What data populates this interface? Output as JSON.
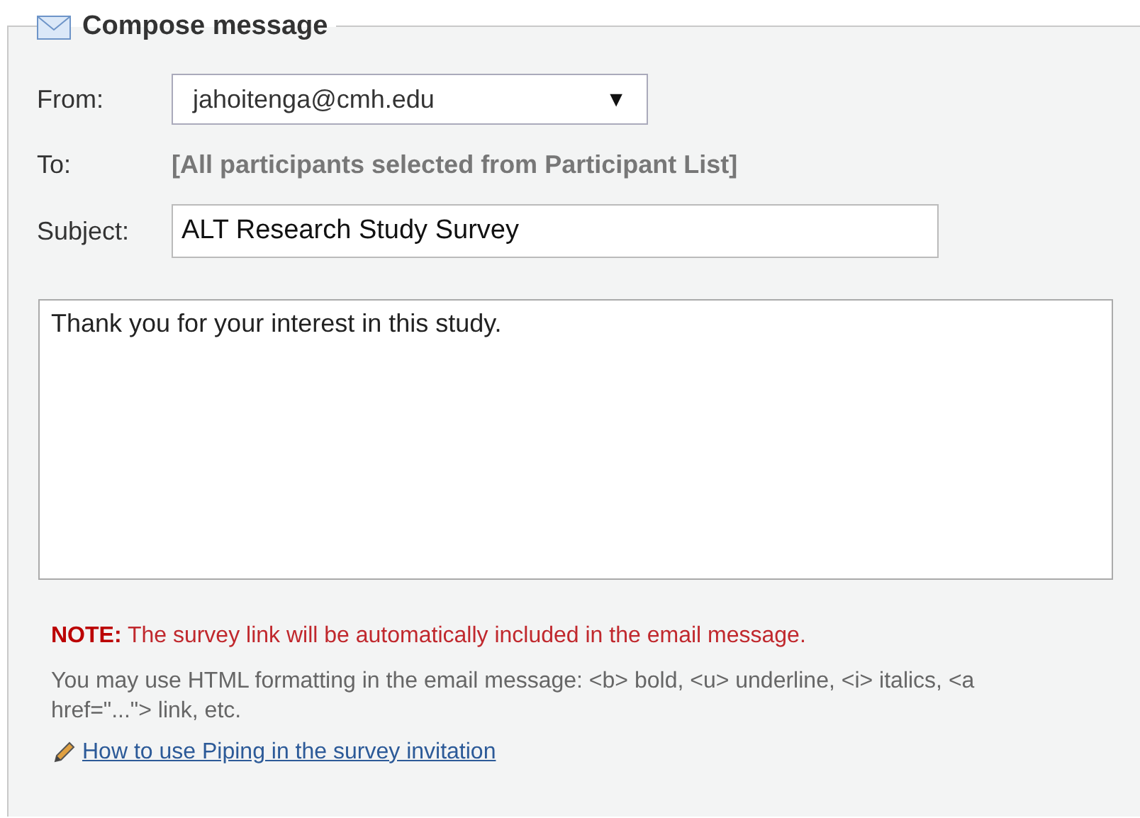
{
  "panel": {
    "title": "Compose message"
  },
  "from": {
    "label": "From:",
    "value": "jahoitenga@cmh.edu",
    "arrow": "▼"
  },
  "to": {
    "label": "To:",
    "value": "[All participants selected from Participant List]"
  },
  "subject": {
    "label": "Subject:",
    "value": "ALT Research Study Survey"
  },
  "body": {
    "value": "Thank you for your interest in this study."
  },
  "note": "**NOTE:** The survey link will be automatically included in the email message.",
  "help": "You may use HTML formatting in the email message: <b> bold, <u> underline, <i> italics, <a href=\"...\"> link, etc.",
  "link": "How to use Piping in the survey invitation"
}
